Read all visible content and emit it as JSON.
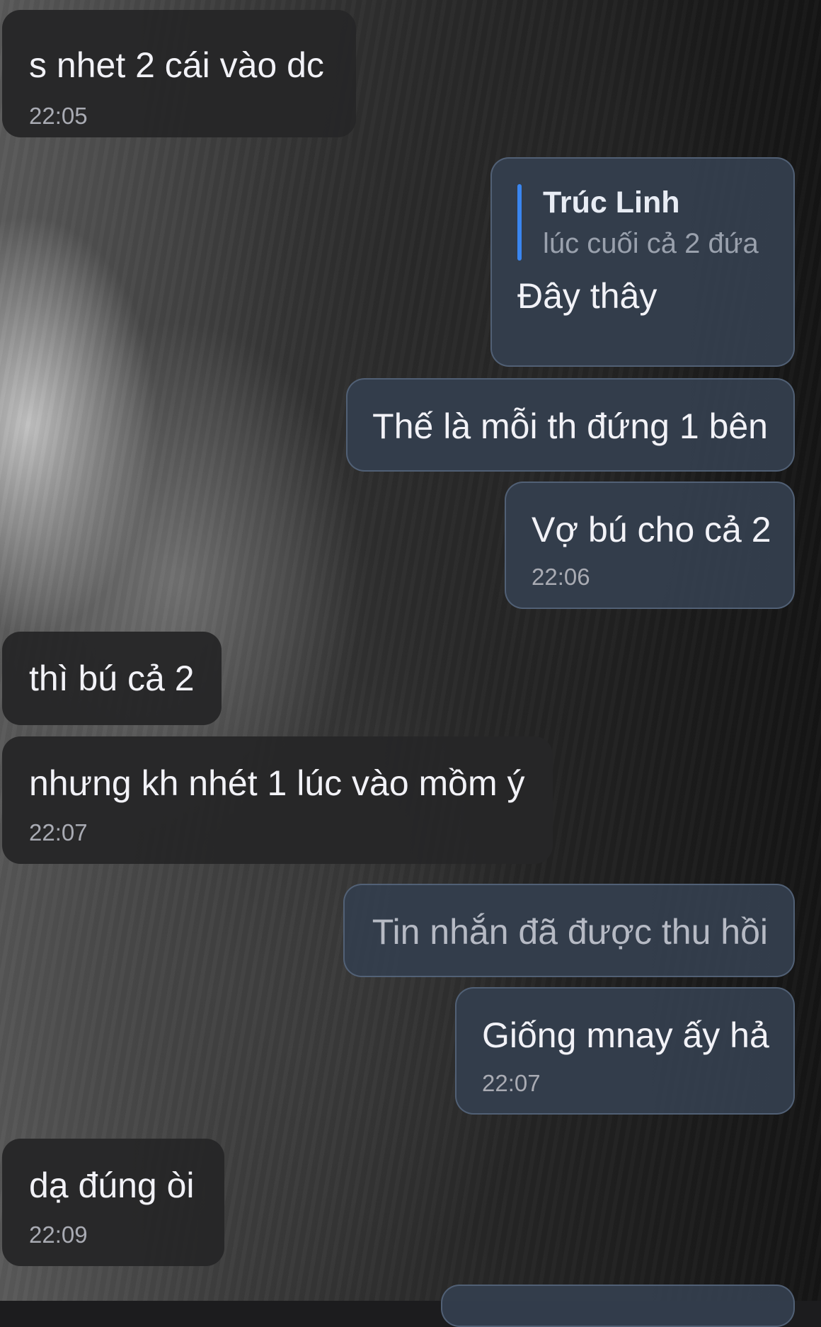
{
  "messages": [
    {
      "side": "in",
      "text": "s nhet 2 cái vào dc",
      "time": "22:05"
    },
    {
      "side": "out",
      "reply": {
        "name": "Trúc Linh",
        "text": "lúc cuối cả 2 đứa"
      },
      "text": "Đây thây"
    },
    {
      "side": "out",
      "text": "Thế là mỗi th đứng 1 bên"
    },
    {
      "side": "out",
      "text": "Vợ bú cho cả 2",
      "time": "22:06"
    },
    {
      "side": "in",
      "text": "thì bú cả 2"
    },
    {
      "side": "in",
      "text": "nhưng kh nhét 1 lúc vào mồm ý",
      "time": "22:07"
    },
    {
      "side": "out",
      "text": "Tin nhắn đã được thu hồi",
      "recalled": true
    },
    {
      "side": "out",
      "text": "Giống mnay ấy hả",
      "time": "22:07"
    },
    {
      "side": "in",
      "text": "dạ đúng òi",
      "time": "22:09"
    }
  ]
}
